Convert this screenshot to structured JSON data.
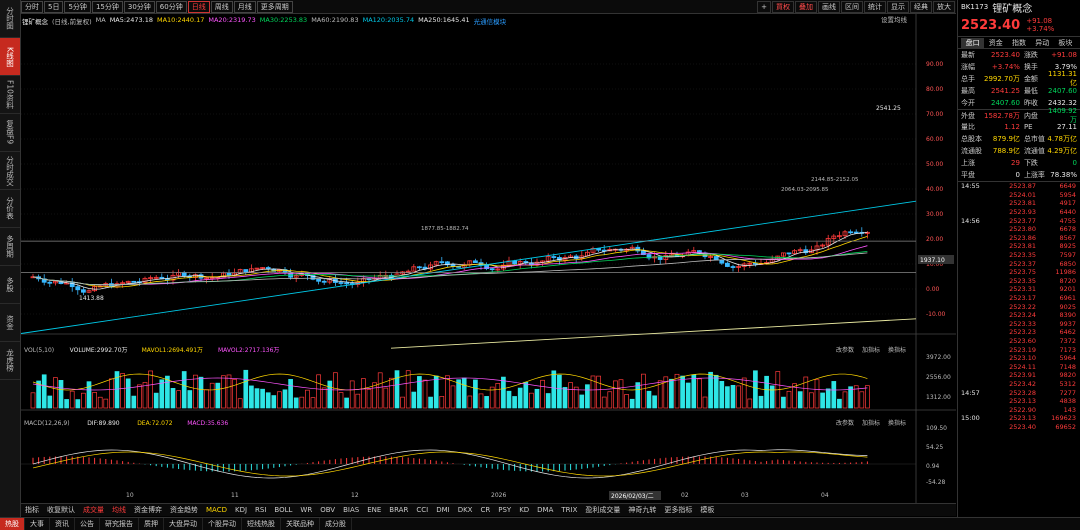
{
  "left_tabs": [
    "分时图",
    "K线图",
    "F10资料",
    "复盘F9",
    "分时成交",
    "分价表",
    "多周期",
    "多股",
    "资金",
    "龙虎榜"
  ],
  "left_active": 1,
  "periods": [
    "分时",
    "5日",
    "5分钟",
    "15分钟",
    "30分钟",
    "60分钟",
    "日线",
    "周线",
    "月线",
    "更多周期"
  ],
  "period_active": 6,
  "toolbar_right": [
    {
      "label": "+",
      "red": false
    },
    {
      "label": "買权",
      "red": true
    },
    {
      "label": "叠加",
      "red": true
    },
    {
      "label": "画线",
      "red": false
    },
    {
      "label": "区间",
      "red": false
    },
    {
      "label": "统计",
      "red": false
    },
    {
      "label": "显示",
      "red": false
    },
    {
      "label": "经典",
      "red": false
    },
    {
      "label": "放大",
      "red": false
    }
  ],
  "legend": [
    {
      "text": "锂矿概念",
      "color": "#e8e8e8"
    },
    {
      "text": "(日线,前复权)",
      "color": "#bbbbbb"
    },
    {
      "text": "MA",
      "color": "#bbbbbb"
    },
    {
      "text": "MA5:2473.18",
      "color": "#e8e8e8"
    },
    {
      "text": "MA10:2440.17",
      "color": "#ffd700"
    },
    {
      "text": "MA20:2319.73",
      "color": "#ff55ff"
    },
    {
      "text": "MA30:2253.83",
      "color": "#00d65b"
    },
    {
      "text": "MA60:2190.83",
      "color": "#bbbbbb"
    },
    {
      "text": "MA120:2035.74",
      "color": "#00c8e6"
    },
    {
      "text": "MA250:1645.41",
      "color": "#e8e8e8"
    },
    {
      "text": "光通信模块",
      "color": "#2a9cff"
    }
  ],
  "setting_label": "设置均线",
  "price_axis": [
    "90.00",
    "80.00",
    "70.00",
    "60.00",
    "50.00",
    "40.00",
    "30.00",
    "20.00",
    "10.00",
    "0.00",
    "-10.00"
  ],
  "price_tag": "1937.10",
  "annot": {
    "high": "2541.25",
    "low": "1413.88",
    "a": "2064.03-2095.85",
    "b": "2144.85-2152.05",
    "c": "1877.85-1882.74"
  },
  "vol_legend": [
    {
      "text": "VOL(5,10)",
      "color": "#bbbbbb"
    },
    {
      "text": "VOLUME:2992.70万",
      "color": "#e8e8e8"
    },
    {
      "text": "MAVOL1:2694.491万",
      "color": "#ffd700"
    },
    {
      "text": "MAVOL2:2717.136万",
      "color": "#ff55ff"
    }
  ],
  "panel_buttons": [
    "改参数",
    "加指标",
    "换指标"
  ],
  "vol_axis": [
    "3972.00",
    "2556.00",
    "1312.00"
  ],
  "macd_legend": [
    {
      "text": "MACD(12,26,9)",
      "color": "#bbbbbb"
    },
    {
      "text": "DIF:89.890",
      "color": "#e8e8e8"
    },
    {
      "text": "DEA:72.072",
      "color": "#ffd700"
    },
    {
      "text": "MACD:35.636",
      "color": "#ff55ff"
    }
  ],
  "macd_axis": [
    "109.50",
    "54.25",
    "0.94",
    "-54.28"
  ],
  "time_axis": [
    "10",
    "11",
    "12",
    "2026",
    "01",
    "02",
    "03",
    "04"
  ],
  "time_cursor": "2026/02/03/二",
  "indicator_tabs": [
    "指标",
    "收复默认",
    "成交量",
    "均线",
    "资金博弈",
    "资金趋势",
    "MACD",
    "KDJ",
    "RSI",
    "BOLL",
    "WR",
    "OBV",
    "BIAS",
    "ENE",
    "BRAR",
    "CCI",
    "DMI",
    "DKX",
    "CR",
    "PSY",
    "KD",
    "DMA",
    "TRIX",
    "盈利成交量",
    "神奇九转",
    "更多指标",
    "模板"
  ],
  "bottom_tabs": [
    "热股",
    "大事",
    "资讯",
    "公告",
    "研究报告",
    "质押",
    "大盘异动",
    "个股异动",
    "短线热股",
    "关联品种",
    "成分股"
  ],
  "right": {
    "code": "BK1173",
    "name": "锂矿概念",
    "price": "2523.40",
    "chg": "+91.08",
    "pct": "+3.74%",
    "tabs": [
      "盘口",
      "资金",
      "指数",
      "异动",
      "板块"
    ],
    "quote": [
      [
        "最新",
        "2523.40",
        "涨跌",
        "+91.08"
      ],
      [
        "涨幅",
        "+3.74%",
        "换手",
        "3.79%"
      ],
      [
        "总手",
        "2992.70万",
        "金额",
        "1131.31亿"
      ],
      [
        "最高",
        "2541.25",
        "最低",
        "2407.60"
      ],
      [
        "今开",
        "2407.60",
        "昨收",
        "2432.32"
      ],
      [
        "外盘",
        "1582.78万",
        "内盘",
        "1409.92万"
      ],
      [
        "量比",
        "1.12",
        "PE",
        "27.11"
      ],
      [
        "总股本",
        "879.9亿",
        "总市值",
        "4.78万亿"
      ],
      [
        "流通股",
        "788.9亿",
        "流通值",
        "4.29万亿"
      ],
      [
        "上涨",
        "29",
        "下跌",
        "0"
      ],
      [
        "平盘",
        "0",
        "上涨率",
        "78.38%"
      ]
    ],
    "trades": [
      [
        "14:55",
        "2523.87",
        "6649"
      ],
      [
        "",
        "2524.01",
        "5954"
      ],
      [
        "",
        "2523.81",
        "4917"
      ],
      [
        "",
        "2523.93",
        "6440"
      ],
      [
        "14:56",
        "2523.77",
        "4755"
      ],
      [
        "",
        "2523.80",
        "6678"
      ],
      [
        "",
        "2523.86",
        "8567"
      ],
      [
        "",
        "2523.81",
        "8925"
      ],
      [
        "",
        "2523.35",
        "7597"
      ],
      [
        "",
        "2523.37",
        "6850"
      ],
      [
        "",
        "2523.75",
        "11986"
      ],
      [
        "",
        "2523.35",
        "8720"
      ],
      [
        "",
        "2523.31",
        "9201"
      ],
      [
        "",
        "2523.17",
        "6961"
      ],
      [
        "",
        "2523.22",
        "9025"
      ],
      [
        "",
        "2523.24",
        "8390"
      ],
      [
        "",
        "2523.33",
        "9937"
      ],
      [
        "",
        "2523.23",
        "6462"
      ],
      [
        "",
        "2523.60",
        "7372"
      ],
      [
        "",
        "2523.19",
        "7173"
      ],
      [
        "",
        "2523.10",
        "5964"
      ],
      [
        "",
        "2524.11",
        "7148"
      ],
      [
        "",
        "2523.91",
        "9820"
      ],
      [
        "",
        "2523.42",
        "5312"
      ],
      [
        "14:57",
        "2523.28",
        "7277"
      ],
      [
        "",
        "2523.13",
        "4838"
      ],
      [
        "",
        "2522.90",
        "143"
      ],
      [
        "15:00",
        "2523.13",
        "169623"
      ],
      [
        "",
        "2523.40",
        "69652"
      ]
    ],
    "bottom_tabs": [
      "分笔",
      "分时",
      "分价"
    ]
  },
  "chart_data": {
    "type": "candlestick",
    "title": "锂矿概念 (日线,前复权)",
    "x_ticks": [
      "10",
      "11",
      "12",
      "2026",
      "01",
      "02",
      "03",
      "04"
    ],
    "last": {
      "price": 2523.4,
      "high": 2541.25,
      "low": 2407.6,
      "open": 2407.6,
      "prev_close": 2432.32,
      "volume_wan": 2992.7
    },
    "y_ticks_pct": [
      90,
      80,
      70,
      60,
      50,
      40,
      30,
      20,
      10,
      0,
      -10
    ],
    "volume_axis": [
      3972.0,
      2556.0,
      1312.0
    ],
    "macd": {
      "dif": 89.89,
      "dea": 72.072,
      "macd": 35.636,
      "axis": [
        109.5,
        54.25,
        0.94,
        -54.28
      ]
    }
  }
}
